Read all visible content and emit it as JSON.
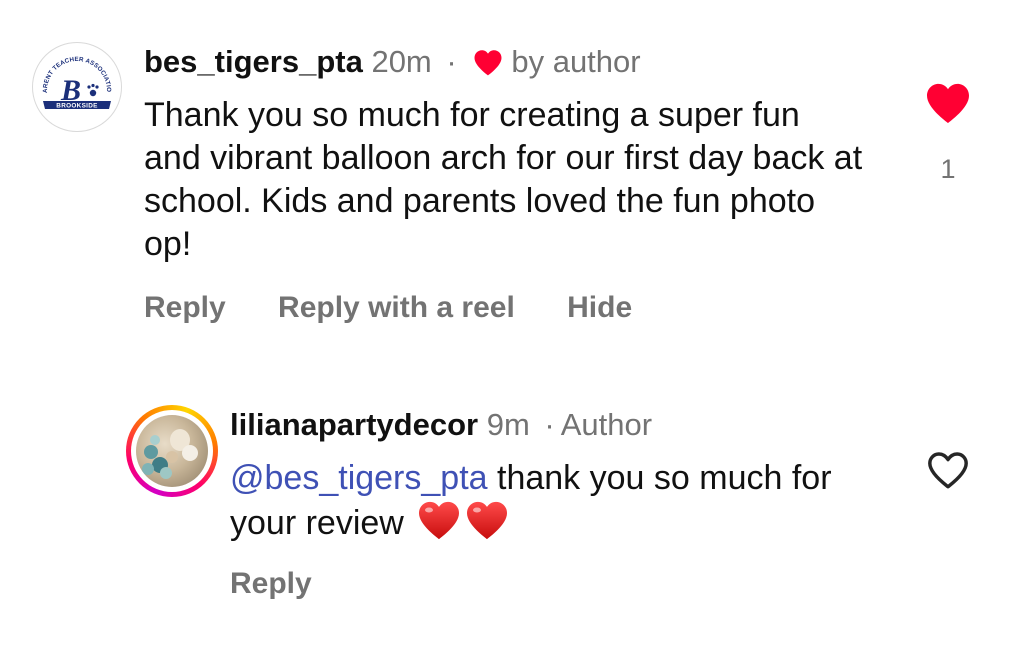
{
  "comment1": {
    "avatar": {
      "icon": "brookside-pta-logo",
      "logo_top_text": "PARENT TEACHER ASSOCIATION",
      "logo_letter": "B",
      "logo_banner_text": "BROOKSIDE"
    },
    "username": "bes_tigers_pta",
    "time": "20m",
    "separator": "·",
    "liked_by": "by author",
    "text": "Thank you so much for creating a super fun and vibrant balloon arch for our first day back at school. Kids and parents loved the fun photo op!",
    "actions": {
      "reply": "Reply",
      "reply_with_reel": "Reply with a reel",
      "hide": "Hide"
    },
    "like": {
      "icon": "heart-filled-icon",
      "liked": true,
      "count": "1",
      "color": "#ff0033"
    }
  },
  "comment2": {
    "avatar": {
      "icon": "balloon-photo-avatar",
      "has_story_ring": true
    },
    "username": "lilianapartydecor",
    "time": "9m",
    "separator": "·",
    "badge": "Author",
    "mention": "@bes_tigers_pta",
    "text": " thank you so much for your review ",
    "emojis": [
      "red-heart-emoji",
      "red-heart-emoji"
    ],
    "actions": {
      "reply": "Reply"
    },
    "like": {
      "icon": "heart-outline-icon",
      "liked": false
    }
  },
  "colors": {
    "text": "#111111",
    "meta": "#737373",
    "mention": "#3f51b5",
    "heart": "#ff0033"
  }
}
